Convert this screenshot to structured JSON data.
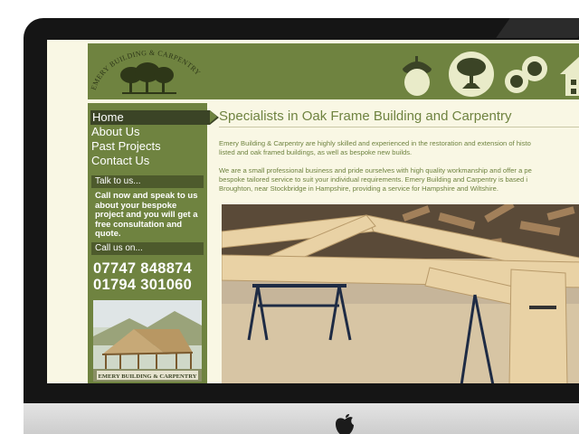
{
  "site": {
    "logo_text": "EMERY BUILDING & CARPENTRY",
    "nav": [
      {
        "label": "Home",
        "active": true
      },
      {
        "label": "About Us",
        "active": false
      },
      {
        "label": "Past Projects",
        "active": false
      },
      {
        "label": "Contact Us",
        "active": false
      }
    ],
    "talk_title": "Talk to us...",
    "talk_text": "Call now and speak to us about your bespoke project and you will get a free consultation and quote.",
    "call_title": "Call us on...",
    "phones": [
      "07747 848874",
      "01794 301060"
    ],
    "sidebar_photo_caption": "EMERY BUILDING & CARPENTRY",
    "heading": "Specialists in Oak Frame Building and Carpentry",
    "paragraph1_line1": "Emery Building & Carpentry are highly skilled and experienced in the restoration and extension of histo",
    "paragraph1_line2": "listed and oak framed buildings, as well as bespoke new builds.",
    "paragraph2_line1": "We are a small professional business and pride ourselves with high quality workmanship and offer a pe",
    "paragraph2_line2": "bespoke tailored service to suit your individual requirements. Emery Building and Carpentry is based i",
    "paragraph2_line3": "Broughton, near Stockbridge in Hampshire, providing a service for Hampshire and Wiltshire.",
    "header_icons": [
      "acorn-icon",
      "oak-tree-icon",
      "timber-logs-icon",
      "house-icon"
    ]
  },
  "colors": {
    "brand_green": "#6f8340",
    "dark_green": "#3b4426",
    "cream": "#f9f7e4",
    "icon_cream": "#e9ebc9"
  }
}
